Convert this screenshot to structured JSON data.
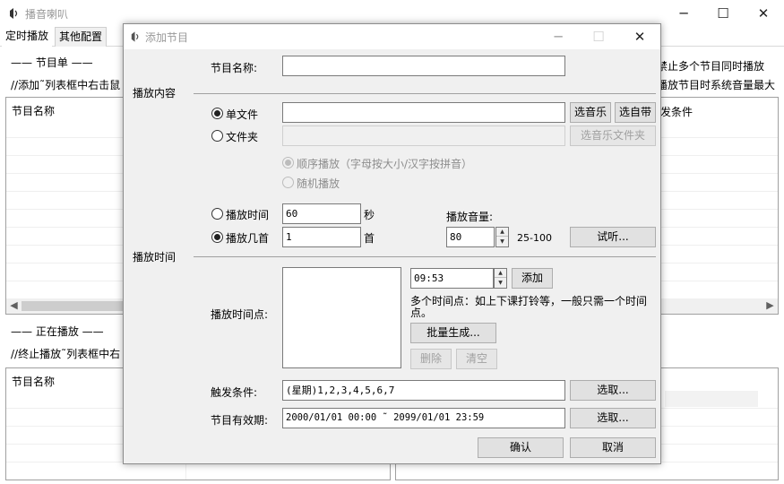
{
  "main_window": {
    "title": "播音喇叭",
    "controls": {
      "minimize": "─",
      "maximize": "☐",
      "close": "✕"
    },
    "tabs": [
      {
        "label": "定时播放"
      },
      {
        "label": "其他配置"
      }
    ],
    "program_list_section": "—— 节目单 ——",
    "program_list_hint": "//添加˜列表框中右击鼠",
    "right_hint_1": "禁止多个节目同时播放",
    "right_hint_2": "播放节目时系统音量最大",
    "list_header": "节目名称",
    "list_header_right": "发条件",
    "playing_section": "—— 正在播放 ——",
    "playing_hint": "//终止播放˜列表框中右",
    "playing_list_header": "节目名称"
  },
  "dialog": {
    "title": "添加节目",
    "controls": {
      "minimize": "─",
      "maximize": "☐",
      "close": "✕"
    },
    "program_name_label": "节目名称:",
    "program_name_value": "",
    "content_section": "播放内容",
    "single_file_label": "单文件",
    "single_file_value": "",
    "choose_music_button": "选音乐",
    "choose_bundled_button": "选自带",
    "folder_label": "文件夹",
    "folder_value": "",
    "choose_folder_button": "选音乐文件夹",
    "sequential_label": "顺序播放（字母按大小/汉字按拼音）",
    "random_label": "随机播放",
    "play_duration_label": "播放时间",
    "play_duration_value": "60",
    "seconds_unit": "秒",
    "play_count_label": "播放几首",
    "play_count_value": "1",
    "songs_unit": "首",
    "volume_label": "播放音量:",
    "volume_value": "80",
    "volume_range": "25-100",
    "preview_button": "试听...",
    "time_section": "播放时间",
    "time_points_label": "播放时间点:",
    "time_input_value": "09:53",
    "add_button": "添加",
    "multi_time_hint": "多个时间点：如上下课打铃等，一般只需一个时间点。",
    "batch_generate_button": "批量生成...",
    "delete_button": "删除",
    "clear_button": "清空",
    "trigger_label": "触发条件:",
    "trigger_value": "(星期)1,2,3,4,5,6,7",
    "trigger_select_button": "选取...",
    "validity_label": "节目有效期:",
    "validity_value": "2000/01/01 00:00 ˜ 2099/01/01 23:59",
    "validity_select_button": "选取...",
    "ok_button": "确认",
    "cancel_button": "取消"
  }
}
